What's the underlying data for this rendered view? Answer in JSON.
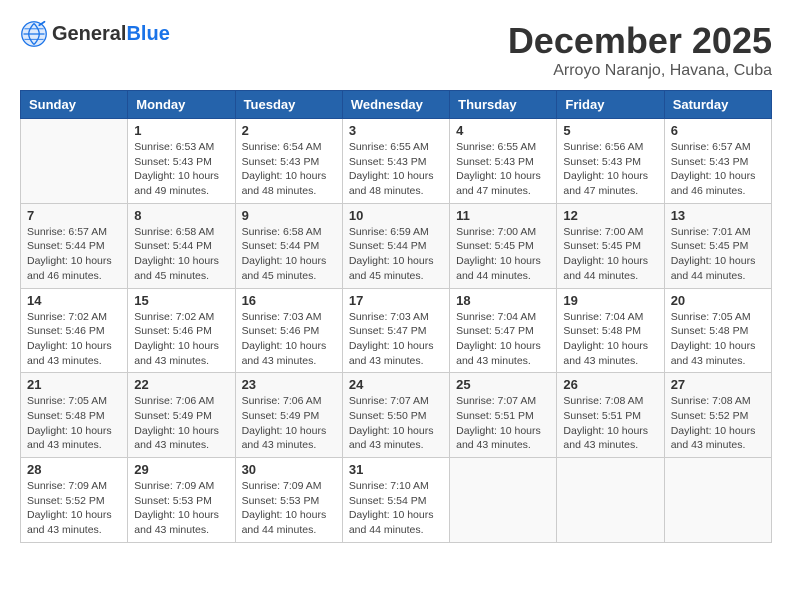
{
  "header": {
    "logo_general": "General",
    "logo_blue": "Blue",
    "title": "December 2025",
    "location": "Arroyo Naranjo, Havana, Cuba"
  },
  "weekdays": [
    "Sunday",
    "Monday",
    "Tuesday",
    "Wednesday",
    "Thursday",
    "Friday",
    "Saturday"
  ],
  "weeks": [
    [
      {
        "day": "",
        "info": ""
      },
      {
        "day": "1",
        "info": "Sunrise: 6:53 AM\nSunset: 5:43 PM\nDaylight: 10 hours\nand 49 minutes."
      },
      {
        "day": "2",
        "info": "Sunrise: 6:54 AM\nSunset: 5:43 PM\nDaylight: 10 hours\nand 48 minutes."
      },
      {
        "day": "3",
        "info": "Sunrise: 6:55 AM\nSunset: 5:43 PM\nDaylight: 10 hours\nand 48 minutes."
      },
      {
        "day": "4",
        "info": "Sunrise: 6:55 AM\nSunset: 5:43 PM\nDaylight: 10 hours\nand 47 minutes."
      },
      {
        "day": "5",
        "info": "Sunrise: 6:56 AM\nSunset: 5:43 PM\nDaylight: 10 hours\nand 47 minutes."
      },
      {
        "day": "6",
        "info": "Sunrise: 6:57 AM\nSunset: 5:43 PM\nDaylight: 10 hours\nand 46 minutes."
      }
    ],
    [
      {
        "day": "7",
        "info": "Sunrise: 6:57 AM\nSunset: 5:44 PM\nDaylight: 10 hours\nand 46 minutes."
      },
      {
        "day": "8",
        "info": "Sunrise: 6:58 AM\nSunset: 5:44 PM\nDaylight: 10 hours\nand 45 minutes."
      },
      {
        "day": "9",
        "info": "Sunrise: 6:58 AM\nSunset: 5:44 PM\nDaylight: 10 hours\nand 45 minutes."
      },
      {
        "day": "10",
        "info": "Sunrise: 6:59 AM\nSunset: 5:44 PM\nDaylight: 10 hours\nand 45 minutes."
      },
      {
        "day": "11",
        "info": "Sunrise: 7:00 AM\nSunset: 5:45 PM\nDaylight: 10 hours\nand 44 minutes."
      },
      {
        "day": "12",
        "info": "Sunrise: 7:00 AM\nSunset: 5:45 PM\nDaylight: 10 hours\nand 44 minutes."
      },
      {
        "day": "13",
        "info": "Sunrise: 7:01 AM\nSunset: 5:45 PM\nDaylight: 10 hours\nand 44 minutes."
      }
    ],
    [
      {
        "day": "14",
        "info": "Sunrise: 7:02 AM\nSunset: 5:46 PM\nDaylight: 10 hours\nand 43 minutes."
      },
      {
        "day": "15",
        "info": "Sunrise: 7:02 AM\nSunset: 5:46 PM\nDaylight: 10 hours\nand 43 minutes."
      },
      {
        "day": "16",
        "info": "Sunrise: 7:03 AM\nSunset: 5:46 PM\nDaylight: 10 hours\nand 43 minutes."
      },
      {
        "day": "17",
        "info": "Sunrise: 7:03 AM\nSunset: 5:47 PM\nDaylight: 10 hours\nand 43 minutes."
      },
      {
        "day": "18",
        "info": "Sunrise: 7:04 AM\nSunset: 5:47 PM\nDaylight: 10 hours\nand 43 minutes."
      },
      {
        "day": "19",
        "info": "Sunrise: 7:04 AM\nSunset: 5:48 PM\nDaylight: 10 hours\nand 43 minutes."
      },
      {
        "day": "20",
        "info": "Sunrise: 7:05 AM\nSunset: 5:48 PM\nDaylight: 10 hours\nand 43 minutes."
      }
    ],
    [
      {
        "day": "21",
        "info": "Sunrise: 7:05 AM\nSunset: 5:48 PM\nDaylight: 10 hours\nand 43 minutes."
      },
      {
        "day": "22",
        "info": "Sunrise: 7:06 AM\nSunset: 5:49 PM\nDaylight: 10 hours\nand 43 minutes."
      },
      {
        "day": "23",
        "info": "Sunrise: 7:06 AM\nSunset: 5:49 PM\nDaylight: 10 hours\nand 43 minutes."
      },
      {
        "day": "24",
        "info": "Sunrise: 7:07 AM\nSunset: 5:50 PM\nDaylight: 10 hours\nand 43 minutes."
      },
      {
        "day": "25",
        "info": "Sunrise: 7:07 AM\nSunset: 5:51 PM\nDaylight: 10 hours\nand 43 minutes."
      },
      {
        "day": "26",
        "info": "Sunrise: 7:08 AM\nSunset: 5:51 PM\nDaylight: 10 hours\nand 43 minutes."
      },
      {
        "day": "27",
        "info": "Sunrise: 7:08 AM\nSunset: 5:52 PM\nDaylight: 10 hours\nand 43 minutes."
      }
    ],
    [
      {
        "day": "28",
        "info": "Sunrise: 7:09 AM\nSunset: 5:52 PM\nDaylight: 10 hours\nand 43 minutes."
      },
      {
        "day": "29",
        "info": "Sunrise: 7:09 AM\nSunset: 5:53 PM\nDaylight: 10 hours\nand 43 minutes."
      },
      {
        "day": "30",
        "info": "Sunrise: 7:09 AM\nSunset: 5:53 PM\nDaylight: 10 hours\nand 44 minutes."
      },
      {
        "day": "31",
        "info": "Sunrise: 7:10 AM\nSunset: 5:54 PM\nDaylight: 10 hours\nand 44 minutes."
      },
      {
        "day": "",
        "info": ""
      },
      {
        "day": "",
        "info": ""
      },
      {
        "day": "",
        "info": ""
      }
    ]
  ]
}
